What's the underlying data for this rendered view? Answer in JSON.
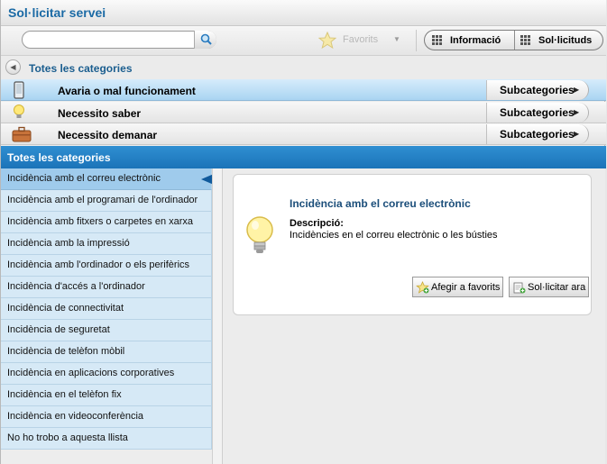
{
  "window": {
    "title": "Sol·licitar servei"
  },
  "toolbar": {
    "search_placeholder": "",
    "favorites_label": "Favorits",
    "info_label": "Informació",
    "requests_label": "Sol·licituds"
  },
  "breadcrumb": {
    "label": "Totes les categories"
  },
  "categories": [
    {
      "label": "Avaria o mal funcionament",
      "sub": "Subcategories",
      "icon": "phone-icon"
    },
    {
      "label": "Necessito saber",
      "sub": "Subcategories",
      "icon": "lightbulb-icon"
    },
    {
      "label": "Necessito demanar",
      "sub": "Subcategories",
      "icon": "briefcase-icon"
    }
  ],
  "panel": {
    "title": "Totes les categories"
  },
  "items": [
    "Incidència amb el correu electrònic",
    "Incidència amb el programari de l'ordinador",
    "Incidència amb fitxers o carpetes en xarxa",
    "Incidència amb la impressió",
    "Incidència amb l'ordinador o els perifèrics",
    "Incidència d'accés a l'ordinador",
    "Incidència de connectivitat",
    "Incidència de seguretat",
    "Incidència de telèfon mòbil",
    "Incidència en aplicacions corporatives",
    "Incidència en el telèfon fix",
    "Incidència en videoconferència",
    "No ho trobo a aquesta llista"
  ],
  "detail": {
    "title": "Incidència amb el correu electrònic",
    "desc_label": "Descripció:",
    "desc_text": "Incidències en el correu electrònic o les bústies",
    "fav_button": "Afegir a favorits",
    "request_button": "Sol·licitar ara"
  },
  "colors": {
    "accent": "#1b73b8",
    "selected_row": "#9fcbec",
    "list_row": "#d6e9f6"
  }
}
